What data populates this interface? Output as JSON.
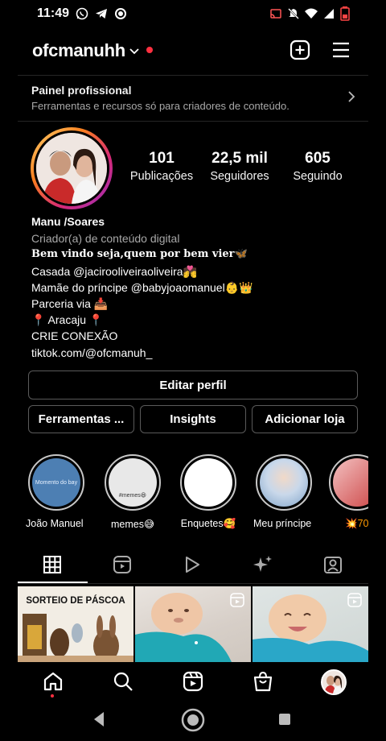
{
  "status_bar": {
    "time": "11:49",
    "icons": [
      "whatsapp-icon",
      "telegram-icon",
      "record-icon",
      "cast-icon",
      "mute-icon",
      "wifi-icon",
      "signal-icon",
      "battery-icon"
    ]
  },
  "header": {
    "username": "ofcmanuhh",
    "icons": [
      "chevron-down-icon",
      "create-icon",
      "menu-icon"
    ],
    "notification_color": "#ff3040"
  },
  "professional_panel": {
    "title": "Painel profissional",
    "subtitle": "Ferramentas e recursos só para criadores de conteúdo."
  },
  "profile": {
    "stats": [
      {
        "value": "101",
        "label": "Publicações"
      },
      {
        "value": "22,5 mil",
        "label": "Seguidores"
      },
      {
        "value": "605",
        "label": "Seguindo"
      }
    ],
    "name": "Manu /Soares",
    "category": "Criador(a) de conteúdo digital",
    "bio_lines": [
      "Bem vindo seja,quem por bem vier🦋",
      "Casada  @jacirooliveiraoliveira💏",
      "Mamãe do príncipe @babyjoaomanuel👶👑",
      "Parceria via 📥",
      " 📍 Aracaju 📍",
      " CRIE CONEXÃO",
      "tiktok.com/@ofcmanuh_"
    ]
  },
  "actions": {
    "edit_profile": "Editar perfil",
    "tools": "Ferramentas ...",
    "insights": "Insights",
    "add_shop": "Adicionar loja"
  },
  "highlights": [
    {
      "label": "João Manuel ...",
      "cover_text": "Momento do bay",
      "cover_color": "#4d7fb3"
    },
    {
      "label": "memes😅",
      "cover_text": "#memes😆",
      "cover_color": "#e8e8e8"
    },
    {
      "label": "Enquetes🥰",
      "cover_text": "",
      "cover_color": "#ffffff"
    },
    {
      "label": "Meu príncipe ...",
      "cover_text": "",
      "cover_color": "#9bb7d4"
    },
    {
      "label": "💥70",
      "cover_text": "",
      "cover_color": "#d66"
    }
  ],
  "tabs": [
    "grid-icon",
    "reels-tab-icon",
    "video-play-icon",
    "sparkle-icon",
    "tagged-icon"
  ],
  "posts": [
    {
      "caption": "SORTEIO DE PÁSCOA",
      "type": "photo"
    },
    {
      "caption": "",
      "type": "reel",
      "badge_icon": "reel-badge-icon"
    },
    {
      "caption": "",
      "type": "reel",
      "badge_icon": "reel-badge-icon"
    }
  ],
  "bottom_nav": [
    "home-icon",
    "search-icon",
    "reels-icon",
    "shop-icon",
    "profile-avatar"
  ],
  "system_nav": [
    "back-icon",
    "home-circle-icon",
    "recents-icon"
  ]
}
